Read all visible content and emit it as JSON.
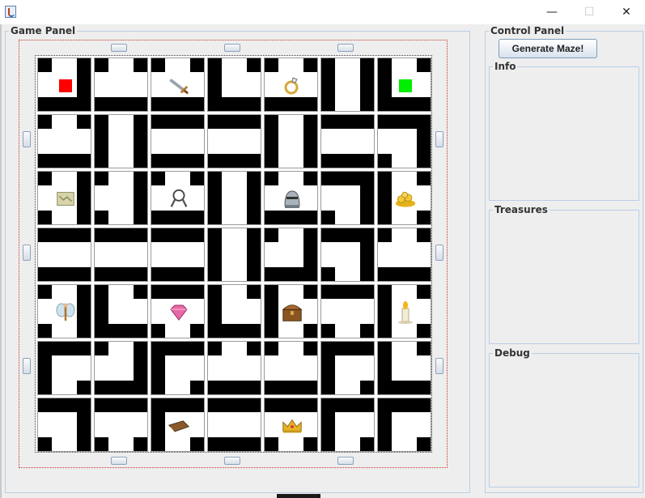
{
  "window": {
    "minimize_glyph": "—",
    "maximize_glyph": "☐",
    "close_glyph": "✕"
  },
  "game_panel": {
    "title": "Game Panel"
  },
  "control_panel": {
    "title": "Control Panel",
    "generate_button": "Generate Maze!",
    "info_title": "Info",
    "treasures_title": "Treasures",
    "debug_title": "Debug"
  },
  "colors": {
    "wall": "#000000",
    "floor": "#ffffff",
    "start_marker": "#ff0000",
    "goal_marker": "#00ee00",
    "group_border": "#b8cfe5",
    "board_border_dotted": "#c0392b"
  },
  "maze": {
    "rows": 7,
    "cols": 7,
    "tiles": [
      [
        "corner-NW",
        "tee-S",
        "tee-S",
        "corner-NE",
        "tee-S",
        "straight-V",
        "corner-NE"
      ],
      [
        "tee-S",
        "straight-V",
        "straight-H",
        "straight-H",
        "straight-V",
        "straight-H",
        "corner-SW"
      ],
      [
        "tee-E",
        "tee-E",
        "tee-S",
        "straight-V",
        "tee-S",
        "corner-SW",
        "tee-W"
      ],
      [
        "straight-H",
        "straight-H",
        "straight-H",
        "straight-V",
        "corner-NW",
        "corner-SW",
        "tee-S"
      ],
      [
        "tee-E",
        "corner-NE",
        "tee-N",
        "corner-NE",
        "tee-W",
        "tee-N",
        "tee-W"
      ],
      [
        "corner-SE",
        "corner-NW",
        "corner-SE",
        "tee-S",
        "tee-S",
        "corner-SE",
        "corner-NE"
      ],
      [
        "corner-SW",
        "tee-N",
        "corner-SE",
        "straight-H",
        "tee-N",
        "corner-SE",
        "corner-SE"
      ]
    ],
    "treasures": [
      {
        "row": 0,
        "col": 0,
        "icon": "start-square"
      },
      {
        "row": 0,
        "col": 2,
        "icon": "sword-icon"
      },
      {
        "row": 0,
        "col": 4,
        "icon": "ring-icon"
      },
      {
        "row": 0,
        "col": 6,
        "icon": "goal-square"
      },
      {
        "row": 2,
        "col": 0,
        "icon": "map-scroll-icon"
      },
      {
        "row": 2,
        "col": 2,
        "icon": "keys-icon"
      },
      {
        "row": 2,
        "col": 4,
        "icon": "knight-helmet-icon"
      },
      {
        "row": 2,
        "col": 6,
        "icon": "gold-coins-icon"
      },
      {
        "row": 4,
        "col": 0,
        "icon": "fairy-icon"
      },
      {
        "row": 4,
        "col": 2,
        "icon": "gem-icon"
      },
      {
        "row": 4,
        "col": 4,
        "icon": "treasure-chest-icon"
      },
      {
        "row": 4,
        "col": 6,
        "icon": "candle-icon"
      },
      {
        "row": 6,
        "col": 2,
        "icon": "book-icon"
      },
      {
        "row": 6,
        "col": 4,
        "icon": "crown-icon"
      }
    ]
  }
}
